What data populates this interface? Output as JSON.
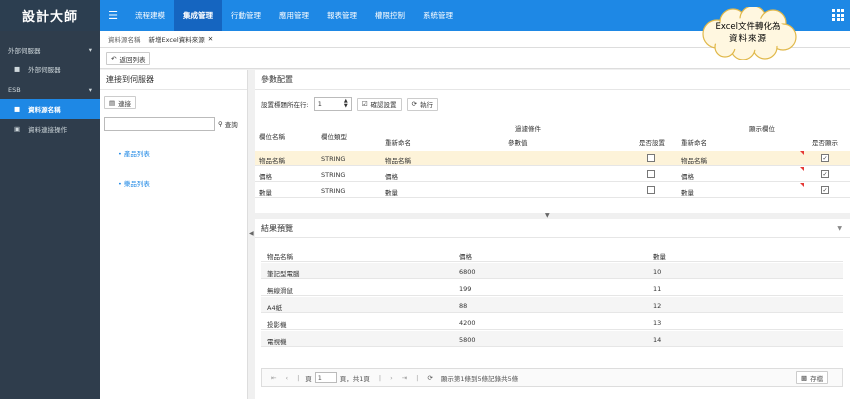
{
  "app": {
    "title": "設計大師"
  },
  "topnav": {
    "items": [
      "流程建模",
      "集成管理",
      "行動管理",
      "應用管理",
      "報表管理",
      "權限控制",
      "系統管理"
    ],
    "active_index": 1
  },
  "sidebar": {
    "group1": "外部伺服器",
    "group1_item": "外部伺服器",
    "group2": "ESB",
    "items": [
      "資料源名稱",
      "資料連接操作"
    ]
  },
  "tabs": {
    "items": [
      "資料源名稱",
      "新增Excel資料來源"
    ]
  },
  "toolbar": {
    "back": "返回列表"
  },
  "left_panel": {
    "title": "連接到伺服器",
    "connect": "連接",
    "search_placeholder": "",
    "search_btn": "查詢",
    "tree": [
      "產品列表",
      "樂品列表"
    ]
  },
  "config": {
    "title": "參數配置",
    "header_row_label": "設置標題所在行:",
    "header_row_value": "1",
    "confirm": "確認設置",
    "execute": "執行",
    "headers": {
      "field_name": "欄位名稱",
      "field_type": "欄位類型",
      "group_filter": "過濾條件",
      "rename": "重新命名",
      "param_value": "參數值",
      "is_set": "是否設置",
      "group_display": "顯示欄位",
      "rename2": "重新命名",
      "is_display": "是否顯示"
    },
    "rows": [
      {
        "name": "物品名稱",
        "type": "STRING",
        "rename": "物品名稱",
        "rename2": "物品名稱"
      },
      {
        "name": "價格",
        "type": "STRING",
        "rename": "價格",
        "rename2": "價格"
      },
      {
        "name": "數量",
        "type": "STRING",
        "rename": "數量",
        "rename2": "數量"
      }
    ]
  },
  "preview": {
    "title": "結果預覽",
    "columns": [
      "物品名稱",
      "價格",
      "數量"
    ],
    "rows": [
      [
        "筆記型電腦",
        "6800",
        "10"
      ],
      [
        "無線滑鼠",
        "199",
        "11"
      ],
      [
        "A4紙",
        "88",
        "12"
      ],
      [
        "投影機",
        "4200",
        "13"
      ],
      [
        "電視機",
        "5800",
        "14"
      ]
    ]
  },
  "pager": {
    "page_label": "頁",
    "page_value": "1",
    "of_label": "頁，共1頁",
    "summary": "顯示第1條到5條記錄共5條",
    "save": "存檔"
  },
  "callout": {
    "line1": "Excel文件轉化為",
    "line2": "資料來源"
  }
}
